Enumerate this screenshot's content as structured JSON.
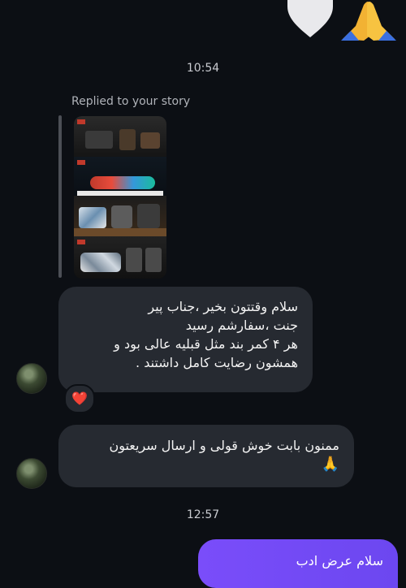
{
  "top_emojis": {
    "heart": "white-heart-icon",
    "pray": "folded-hands-icon"
  },
  "timestamps": {
    "first": "10:54",
    "second": "12:57"
  },
  "story_reply": {
    "label": "Replied to your story"
  },
  "messages": {
    "first": {
      "lines": [
        "سلام وقتتون بخیر ،جناب پیر",
        "جنت ،سفارشم رسید",
        "هر ۴ کمر بند  مثل قبلیه عالی بود و",
        "همشون رضایت کامل داشتند ."
      ],
      "reaction": "❤️"
    },
    "second": {
      "lines": [
        "ممنون بابت خوش قولی و ارسال سریعتون",
        "🙏"
      ]
    },
    "outgoing": {
      "text": "سلام عرض ادب"
    }
  },
  "colors": {
    "background": "#0c0f14",
    "incoming_bubble": "#262a31",
    "outgoing_bubble": "#7a4dfa",
    "reaction_heart": "#e0243f"
  }
}
